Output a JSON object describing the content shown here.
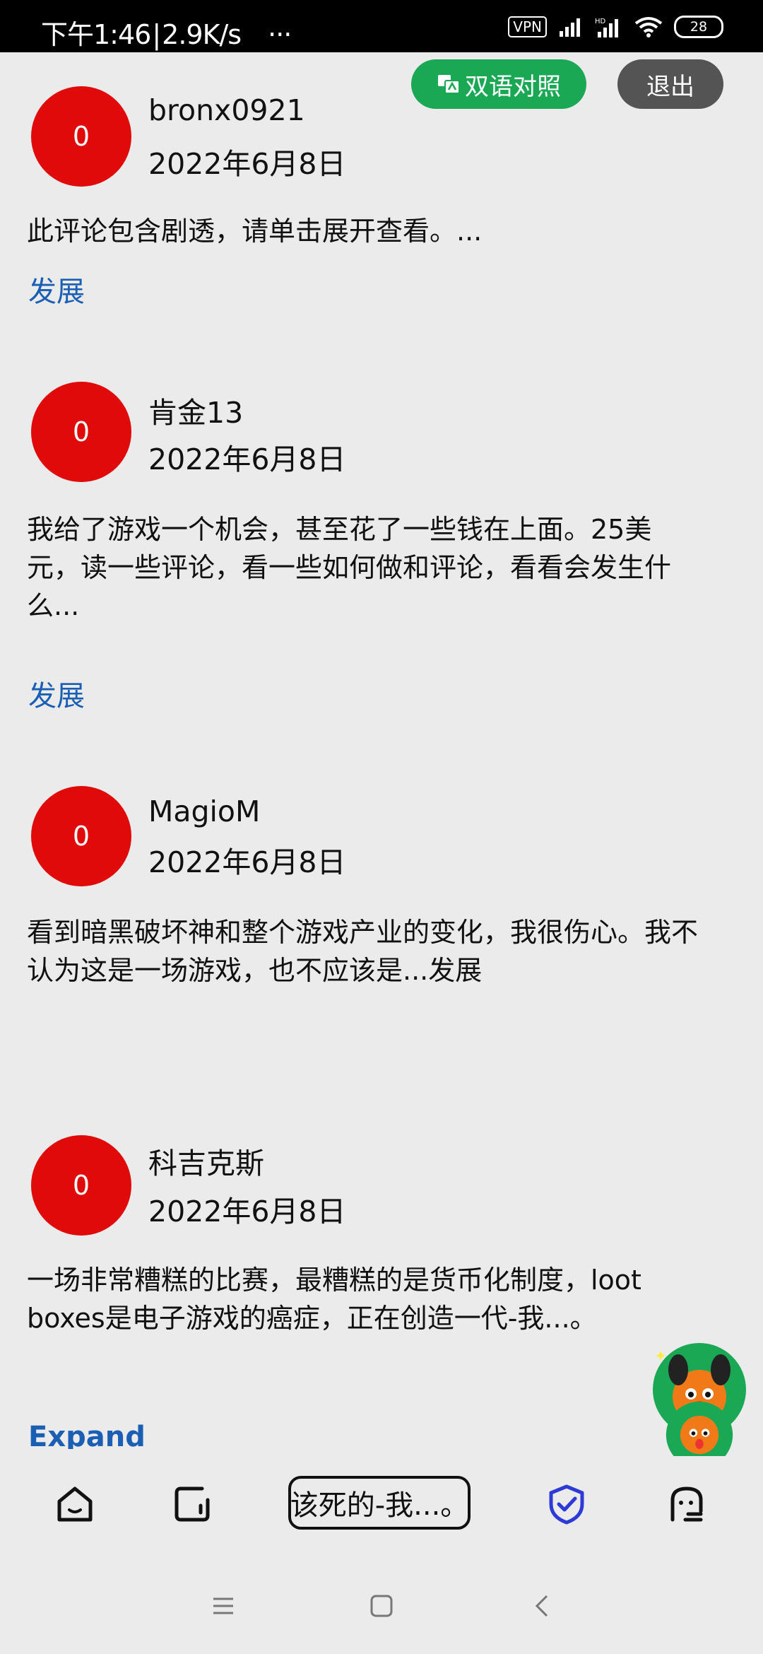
{
  "status_bar": {
    "time": "下午1:46",
    "speed": "2.9K/s",
    "more": "···",
    "vpn": "VPN",
    "battery": "28"
  },
  "actions": {
    "bilingual_label": "双语对照",
    "exit_label": "退出"
  },
  "reviews": [
    {
      "avatar": "0",
      "username": "bronx0921",
      "date": "2022年6月8日",
      "text": "此评论包含剧透，请单击展开查看。...",
      "expand": "发展"
    },
    {
      "avatar": "0",
      "username": "肯金13",
      "date": "2022年6月8日",
      "text": "我给了游戏一个机会，甚至花了一些钱在上面。25美元，读一些评论，看一些如何做和评论，看看会发生什么...",
      "expand": "发展"
    },
    {
      "avatar": "0",
      "username": "MagioM",
      "date": "2022年6月8日",
      "text": "看到暗黑破坏神和整个游戏产业的变化，我很伤心。我不认为这是一场游戏，也不应该是...发展",
      "expand": ""
    },
    {
      "avatar": "0",
      "username": "科吉克斯",
      "date": "2022年6月8日",
      "text": "一场非常糟糕的比赛，最糟糕的是货币化制度，loot boxes是电子游戏的癌症，正在创造一代-我...。",
      "expand": "Expand"
    }
  ],
  "bottom_nav": {
    "search_text": "该死的-我...。"
  },
  "colors": {
    "avatar": "#e00a0a",
    "bilingual_button": "#1aa854",
    "exit_button": "#545454",
    "link": "#1a5fb4",
    "shield_icon": "#2d3ad6"
  }
}
